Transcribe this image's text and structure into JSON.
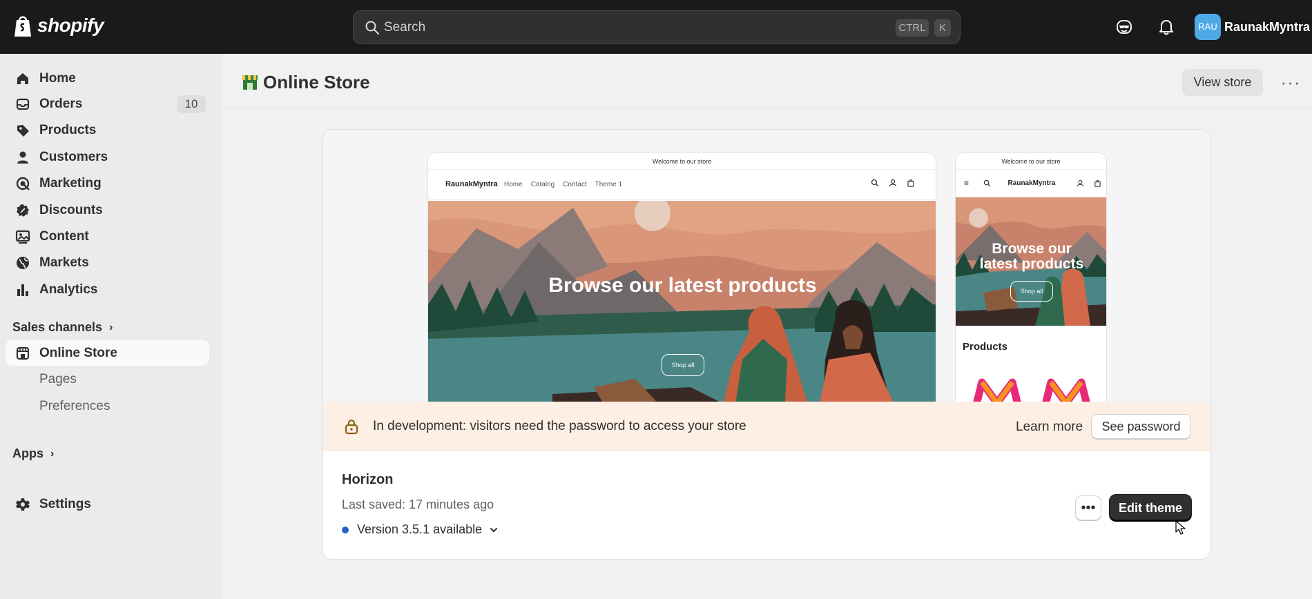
{
  "topbar": {
    "logo_text": "shopify",
    "search_placeholder": "Search",
    "shortcut_ctrl": "CTRL",
    "shortcut_k": "K",
    "avatar_initials": "RAU",
    "username": "RaunakMyntra"
  },
  "sidebar": {
    "items": [
      {
        "label": "Home",
        "icon": "home-icon"
      },
      {
        "label": "Orders",
        "icon": "orders-icon",
        "badge": "10"
      },
      {
        "label": "Products",
        "icon": "tag-icon"
      },
      {
        "label": "Customers",
        "icon": "person-icon"
      },
      {
        "label": "Marketing",
        "icon": "target-icon"
      },
      {
        "label": "Discounts",
        "icon": "discount-icon"
      },
      {
        "label": "Content",
        "icon": "image-icon"
      },
      {
        "label": "Markets",
        "icon": "globe-icon"
      },
      {
        "label": "Analytics",
        "icon": "bar-chart-icon"
      }
    ],
    "sales_channels_label": "Sales channels",
    "online_store_label": "Online Store",
    "subitems": [
      "Pages",
      "Preferences"
    ],
    "apps_label": "Apps",
    "settings_label": "Settings"
  },
  "header": {
    "title": "Online Store",
    "view_store_label": "View store",
    "more_label": "···"
  },
  "preview": {
    "announcement": "Welcome to our store",
    "brand": "RaunakMyntra",
    "nav_links": [
      "Home",
      "Catalog",
      "Contact",
      "Theme 1"
    ],
    "hero_title": "Browse our latest products",
    "mobile_hero_title_line1": "Browse our",
    "mobile_hero_title_line2": "latest products",
    "shop_all_label": "Shop all",
    "mobile_products_label": "Products"
  },
  "banner": {
    "text": "In development: visitors need the password to access your store",
    "learn_more_label": "Learn more",
    "see_password_label": "See password"
  },
  "theme": {
    "name": "Horizon",
    "last_saved": "Last saved: 17 minutes ago",
    "version": "Version 3.5.1 available",
    "more_label": "•••",
    "edit_label": "Edit theme"
  },
  "colors": {
    "topbar": "#1a1a1a",
    "banner": "#fdefe3",
    "version_dot": "#2563c7",
    "primary_button": "#303030"
  }
}
